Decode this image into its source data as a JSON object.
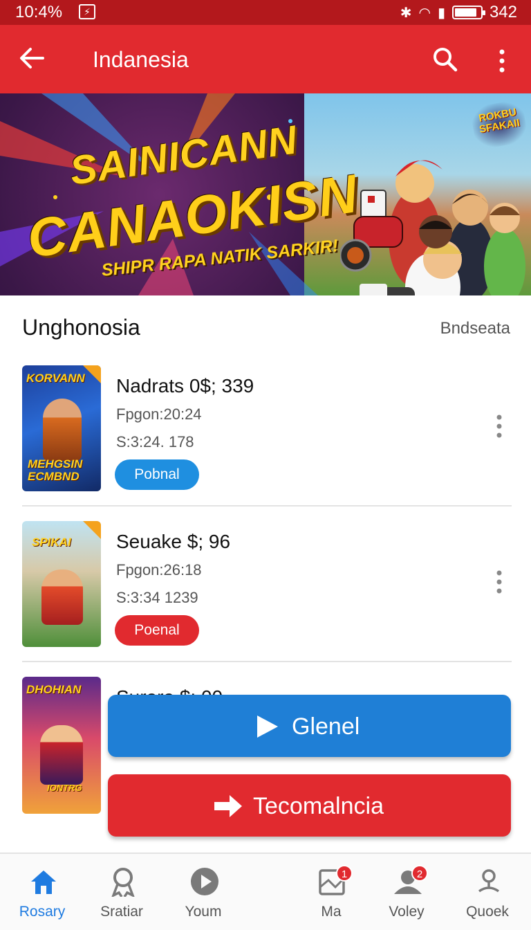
{
  "status_bar": {
    "time": "10:4%",
    "battery_text": "342",
    "battery_level": 0.85,
    "icons": [
      "usb-icon",
      "bluetooth-icon",
      "wifi-icon",
      "signal-icon",
      "battery-icon"
    ]
  },
  "app_bar": {
    "title": "Indanesia",
    "icons": [
      "back-arrow-icon",
      "search-icon",
      "more-vert-icon"
    ],
    "color": "#e12a2f"
  },
  "banner": {
    "headline_line1": "SAINICANN",
    "headline_line2": "CANAOKISN",
    "tagline": "SHIPR RAPA NATIK SARKIR!",
    "badge": "ROKBU SFAKAII"
  },
  "section": {
    "title": "Unghonosia",
    "link": "Bndseata"
  },
  "items": [
    {
      "thumb_title": "KORVANN",
      "thumb_subtitle": "MEHGSIN ECMBND",
      "title": "Nadrats 0$; 339",
      "meta1": "Fpgon:20:24",
      "meta2": "S:3:24. 178",
      "button": "Pobnal",
      "button_color": "#1f8fe0"
    },
    {
      "thumb_title": "SPIKAI",
      "thumb_subtitle": "",
      "title": "Seuake $; 96",
      "meta1": "Fpgon:26:18",
      "meta2": "S:3:34 1239",
      "button": "Poenal",
      "button_color": "#e12a2f"
    },
    {
      "thumb_title": "DHOHIAN",
      "thumb_subtitle": "IONTRG",
      "title": "Surara $; 00"
    }
  ],
  "actions": {
    "primary": {
      "label": "Glenel",
      "color": "#1f7fd6",
      "icon": "play-icon"
    },
    "secondary": {
      "label": "Tecomalncia",
      "color": "#e12a2f",
      "icon": "arrow-right-icon"
    }
  },
  "bottom_nav": [
    {
      "label": "Rosary",
      "icon": "home-icon",
      "active": true
    },
    {
      "label": "Sratiar",
      "icon": "award-icon"
    },
    {
      "label": "Youm",
      "icon": "play-circle-icon"
    },
    {
      "label": "Ma",
      "icon": "map-icon",
      "badge": "1"
    },
    {
      "label": "Voley",
      "icon": "people-icon",
      "badge": "2"
    },
    {
      "label": "Quoek",
      "icon": "person-pin-icon"
    }
  ],
  "colors": {
    "status_bar": "#b3181c",
    "accent_blue": "#1f7be0",
    "accent_red": "#e12a2f"
  }
}
